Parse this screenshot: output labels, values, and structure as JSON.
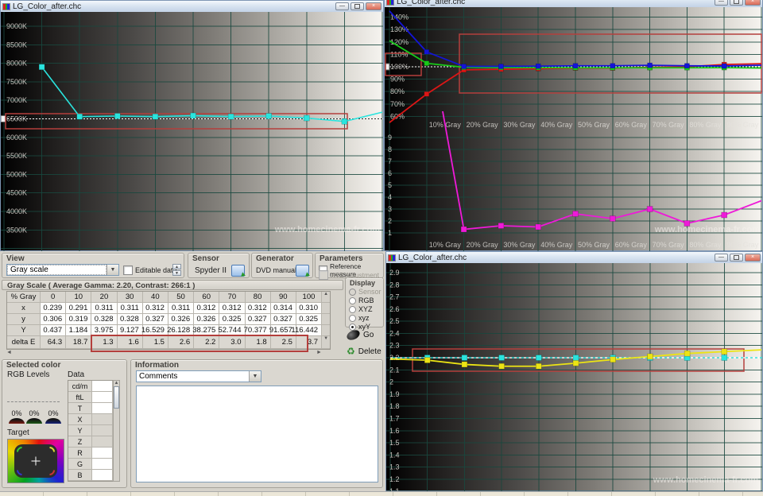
{
  "window_title": "LG_Color_after.chc",
  "watermark": "www.homecinema-fr.com",
  "colors": {
    "cyan": "#2ae4de",
    "blue": "#1414d8",
    "green": "#18c818",
    "red": "#dc1616",
    "magenta": "#ee1ad8",
    "yellow": "#ece414",
    "ref_box": "#b43f3c",
    "grid": "#1d4a42",
    "axis_text": "#c6c4be"
  },
  "charts": {
    "temperature": {
      "y_labels": [
        "9000K",
        "8500K",
        "8000K",
        "7500K",
        "7000K",
        "6500K",
        "6000K",
        "5500K",
        "5000K",
        "4500K",
        "4000K",
        "3500K"
      ],
      "pct": [
        10,
        20,
        30,
        40,
        50,
        60,
        70,
        80,
        90,
        100
      ],
      "kelvin": [
        7900,
        6560,
        6575,
        6560,
        6585,
        6560,
        6575,
        6520,
        6430,
        6680
      ],
      "reference_kelvin": 6500
    },
    "rgb_levels": {
      "y_labels": [
        "140%",
        "130%",
        "120%",
        "110%",
        "100%",
        "90%",
        "80%",
        "70%",
        "60%"
      ],
      "delta_scale_labels": [
        "9",
        "8",
        "7",
        "6",
        "5",
        "4",
        "3",
        "2",
        "1"
      ],
      "x_labels": [
        "10% Gray",
        "20% Gray",
        "30% Gray",
        "40% Gray",
        "50% Gray",
        "60% Gray",
        "70% Gray",
        "80% Gray",
        "90% Gray"
      ],
      "pct": [
        0,
        10,
        20,
        30,
        40,
        50,
        60,
        70,
        80,
        90,
        100
      ],
      "red": [
        55,
        78,
        97.5,
        98,
        98.5,
        99,
        99,
        99.5,
        100,
        101.8,
        102.5
      ],
      "green": [
        121,
        102.8,
        99.6,
        99.4,
        99.3,
        99.2,
        99.2,
        99.2,
        99.2,
        99.3,
        99.0
      ],
      "blue": [
        145,
        112,
        100.3,
        100.3,
        100.5,
        100.8,
        100.8,
        101.2,
        100.8,
        100.6,
        101.3
      ],
      "delta_pct": [
        10,
        20,
        30,
        40,
        50,
        60,
        70,
        80,
        90,
        100
      ],
      "delta_values": [
        18.7,
        1.3,
        1.6,
        1.5,
        2.6,
        2.2,
        3.0,
        1.8,
        2.5,
        3.7
      ],
      "reference_pct": 100
    },
    "gamma": {
      "y_labels": [
        "2.9",
        "2.8",
        "2.7",
        "2.6",
        "2.5",
        "2.4",
        "2.3",
        "2.2",
        "2.1",
        "2",
        "1.9",
        "1.8",
        "1.7",
        "1.6",
        "1.5",
        "1.4",
        "1.3",
        "1.2",
        "1.1"
      ],
      "pct": [
        0,
        10,
        20,
        30,
        40,
        50,
        60,
        70,
        80,
        90,
        100
      ],
      "measured": [
        2.19,
        2.18,
        2.145,
        2.13,
        2.13,
        2.155,
        2.185,
        2.21,
        2.235,
        2.25,
        2.265
      ],
      "reference": 2.2
    }
  },
  "panel": {
    "view": {
      "label": "View",
      "dropdown_value": "Gray scale",
      "editable_label": "Editable data"
    },
    "sensor": {
      "label": "Sensor",
      "value": "Spyder II"
    },
    "generator": {
      "label": "Generator",
      "value": "DVD manual"
    },
    "parameters": {
      "label": "Parameters",
      "reference_label": "Reference measure",
      "xyz_label": "XYZ Adjustment"
    },
    "grayscale_header": "Gray Scale ( Average Gamma: 2.20, Contrast: 266:1 )",
    "table": {
      "columns": [
        "% Gray",
        "0",
        "10",
        "20",
        "30",
        "40",
        "50",
        "60",
        "70",
        "80",
        "90",
        "100"
      ],
      "rows": [
        {
          "label": "x",
          "values": [
            "0.239",
            "0.291",
            "0.311",
            "0.311",
            "0.312",
            "0.311",
            "0.312",
            "0.312",
            "0.312",
            "0.314",
            "0.310"
          ],
          "gray": false
        },
        {
          "label": "y",
          "values": [
            "0.306",
            "0.319",
            "0.328",
            "0.328",
            "0.327",
            "0.326",
            "0.326",
            "0.325",
            "0.327",
            "0.327",
            "0.325"
          ],
          "gray": false
        },
        {
          "label": "Y",
          "values": [
            "0.437",
            "1.184",
            "3.975",
            "9.127",
            "16.529",
            "26.128",
            "38.275",
            "52.744",
            "70.377",
            "91.657",
            "116.442"
          ],
          "gray": false
        },
        {
          "label": "delta E",
          "values": [
            "64.3",
            "18.7",
            "1.3",
            "1.6",
            "1.5",
            "2.6",
            "2.2",
            "3.0",
            "1.8",
            "2.5",
            "3.7"
          ],
          "gray": true
        }
      ]
    },
    "display": {
      "label": "Display",
      "options": [
        {
          "t": "Sensor",
          "disabled": true,
          "selected": false
        },
        {
          "t": "RGB",
          "disabled": false,
          "selected": false
        },
        {
          "t": "XYZ",
          "disabled": false,
          "selected": false
        },
        {
          "t": "xyz",
          "disabled": false,
          "selected": false
        },
        {
          "t": "xyY",
          "disabled": false,
          "selected": true
        }
      ]
    },
    "go_label": "Go",
    "delete_label": "Delete",
    "selected_color": {
      "label": "Selected color",
      "rgb_levels_label": "RGB Levels",
      "data_label": "Data",
      "percents": [
        "0%",
        "0%",
        "0%"
      ],
      "target_label": "Target",
      "data_rows": [
        "cd/m",
        "ftL",
        "T",
        "X",
        "Y",
        "Z",
        "R",
        "G",
        "B"
      ],
      "gray_rows": [
        "X",
        "Y",
        "Z"
      ]
    },
    "information": {
      "label": "Information",
      "comments_value": "Comments"
    }
  }
}
